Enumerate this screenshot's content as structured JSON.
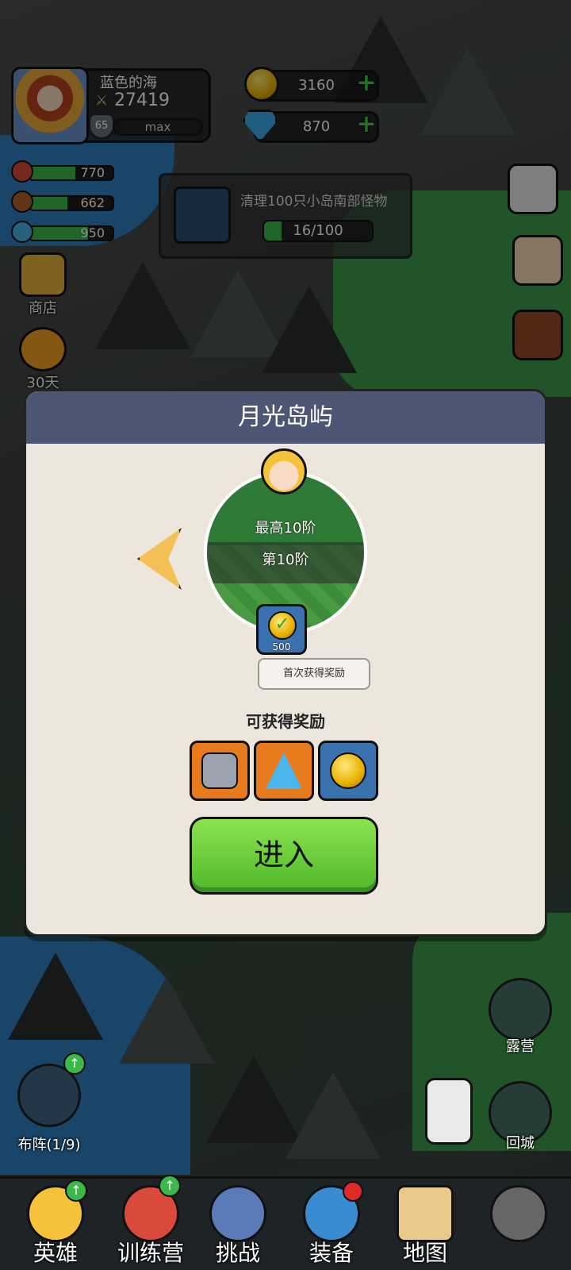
{
  "player": {
    "name": "蓝色的海",
    "power": "27419",
    "level": "65",
    "exp_label": "max"
  },
  "currency": {
    "gold": "3160",
    "diamond": "870"
  },
  "stats": [
    {
      "icon": "meat-icon",
      "value": "770",
      "fill": 0.55,
      "color": "#d94a3a"
    },
    {
      "icon": "wood-icon",
      "value": "662",
      "fill": 0.45,
      "color": "#b0602a"
    },
    {
      "icon": "crystal-icon",
      "value": "950",
      "fill": 0.7,
      "color": "#4ab0e0"
    }
  ],
  "left_menu": {
    "shop_label": "商店",
    "pass_label": "30天"
  },
  "quest": {
    "title": "清理100只小岛南部怪物",
    "progress": "16/100",
    "progress_fraction": 0.16
  },
  "dialog": {
    "title": "月光岛屿",
    "max_stage": "最高10阶",
    "current_stage": "第10阶",
    "first_reward_amount": "500",
    "first_reward_tip": "首次获得奖励",
    "rewards_title": "可获得奖励",
    "enter_label": "进入",
    "rewards": [
      {
        "icon": "ore-stone-icon",
        "bg": "#e87a1e"
      },
      {
        "icon": "blue-crystal-pile-icon",
        "bg": "#e87a1e"
      },
      {
        "icon": "gold-coin-icon",
        "bg": "#3a72b0"
      }
    ]
  },
  "map_buttons": {
    "formation_label": "布阵(1/9)",
    "camp_label": "露营",
    "return_label": "回城"
  },
  "nav": [
    {
      "label": "英雄",
      "icon": "heroes-icon",
      "badge": "up"
    },
    {
      "label": "训练营",
      "icon": "training-target-icon",
      "badge": "up"
    },
    {
      "label": "挑战",
      "icon": "sword-shield-icon",
      "badge": ""
    },
    {
      "label": "装备",
      "icon": "equipment-pot-icon",
      "badge": "red"
    },
    {
      "label": "地图",
      "icon": "map-scroll-icon",
      "badge": ""
    },
    {
      "label": "",
      "icon": "locked-icon",
      "badge": ""
    }
  ]
}
